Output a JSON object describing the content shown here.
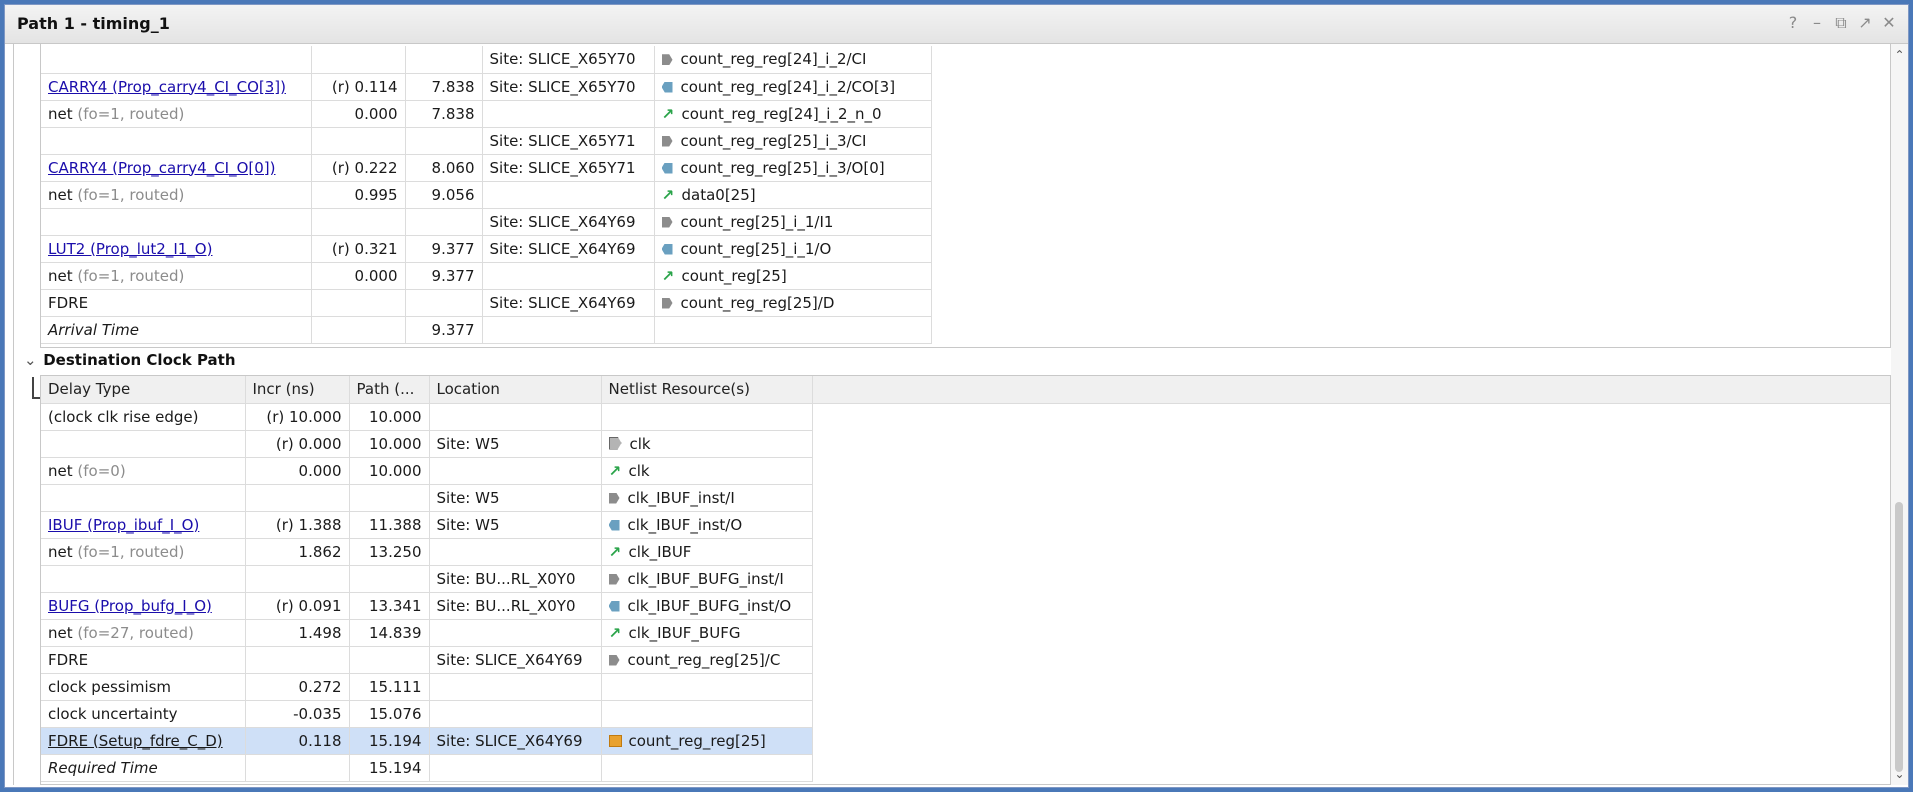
{
  "window": {
    "title": "Path 1 - timing_1",
    "controls": [
      "?",
      "–",
      "⧉",
      "↗",
      "✕"
    ]
  },
  "upper_rows": [
    {
      "delay": "",
      "delay_link": false,
      "incr": "",
      "path": "",
      "location": "Site: SLICE_X65Y70",
      "icon": "pin-in",
      "resource": "count_reg_reg[24]_i_2/CI"
    },
    {
      "delay": "CARRY4 (Prop_carry4_CI_CO[3])",
      "delay_link": true,
      "incr": "(r) 0.114",
      "path": "7.838",
      "location": "Site: SLICE_X65Y70",
      "icon": "pin-out",
      "resource": "count_reg_reg[24]_i_2/CO[3]"
    },
    {
      "delay": "net",
      "muted": "(fo=1, routed)",
      "incr": "0.000",
      "path": "7.838",
      "location": "",
      "icon": "net",
      "resource": "count_reg_reg[24]_i_2_n_0"
    },
    {
      "delay": "",
      "incr": "",
      "path": "",
      "location": "Site: SLICE_X65Y71",
      "icon": "pin-in",
      "resource": "count_reg_reg[25]_i_3/CI"
    },
    {
      "delay": "CARRY4 (Prop_carry4_CI_O[0])",
      "delay_link": true,
      "incr": "(r) 0.222",
      "path": "8.060",
      "location": "Site: SLICE_X65Y71",
      "icon": "pin-out",
      "resource": "count_reg_reg[25]_i_3/O[0]"
    },
    {
      "delay": "net",
      "muted": "(fo=1, routed)",
      "incr": "0.995",
      "path": "9.056",
      "location": "",
      "icon": "net",
      "resource": "data0[25]"
    },
    {
      "delay": "",
      "incr": "",
      "path": "",
      "location": "Site: SLICE_X64Y69",
      "icon": "pin-in",
      "resource": "count_reg[25]_i_1/I1"
    },
    {
      "delay": "LUT2 (Prop_lut2_I1_O)",
      "delay_link": true,
      "incr": "(r) 0.321",
      "path": "9.377",
      "location": "Site: SLICE_X64Y69",
      "icon": "pin-out",
      "resource": "count_reg[25]_i_1/O"
    },
    {
      "delay": "net",
      "muted": "(fo=1, routed)",
      "incr": "0.000",
      "path": "9.377",
      "location": "",
      "icon": "net",
      "resource": "count_reg[25]"
    },
    {
      "delay": "FDRE",
      "incr": "",
      "path": "",
      "location": "Site: SLICE_X64Y69",
      "icon": "pin-in",
      "resource": "count_reg_reg[25]/D"
    },
    {
      "delay": "Arrival Time",
      "bold": true,
      "incr": "",
      "path": "9.377",
      "location": "",
      "icon": "",
      "resource": ""
    }
  ],
  "section": {
    "title": "Destination Clock Path"
  },
  "lower_headers": {
    "delay_type": "Delay Type",
    "incr": "Incr (ns)",
    "path": "Path (...",
    "location": "Location",
    "netlist": "Netlist Resource(s)"
  },
  "lower_rows": [
    {
      "delay": "(clock clk rise edge)",
      "incr": "(r) 10.000",
      "path": "10.000",
      "location": "",
      "icon": "",
      "resource": ""
    },
    {
      "delay": "",
      "incr": "(r) 0.000",
      "path": "10.000",
      "location": "Site: W5",
      "icon": "pin-in-lg",
      "resource": "clk"
    },
    {
      "delay": "net",
      "muted": "(fo=0)",
      "incr": "0.000",
      "path": "10.000",
      "location": "",
      "icon": "net",
      "resource": "clk"
    },
    {
      "delay": "",
      "incr": "",
      "path": "",
      "location": "Site: W5",
      "icon": "pin-in",
      "resource": "clk_IBUF_inst/I"
    },
    {
      "delay": "IBUF (Prop_ibuf_I_O)",
      "delay_link": true,
      "incr": "(r) 1.388",
      "path": "11.388",
      "location": "Site: W5",
      "icon": "pin-out",
      "resource": "clk_IBUF_inst/O"
    },
    {
      "delay": "net",
      "muted": "(fo=1, routed)",
      "incr": "1.862",
      "path": "13.250",
      "location": "",
      "icon": "net",
      "resource": "clk_IBUF"
    },
    {
      "delay": "",
      "incr": "",
      "path": "",
      "location": "Site: BU...RL_X0Y0",
      "icon": "pin-in",
      "resource": "clk_IBUF_BUFG_inst/I"
    },
    {
      "delay": "BUFG (Prop_bufg_I_O)",
      "delay_link": true,
      "incr": "(r) 0.091",
      "path": "13.341",
      "location": "Site: BU...RL_X0Y0",
      "icon": "pin-out",
      "resource": "clk_IBUF_BUFG_inst/O"
    },
    {
      "delay": "net",
      "muted": "(fo=27, routed)",
      "incr": "1.498",
      "path": "14.839",
      "location": "",
      "icon": "net",
      "resource": "clk_IBUF_BUFG"
    },
    {
      "delay": "FDRE",
      "incr": "",
      "path": "",
      "location": "Site: SLICE_X64Y69",
      "icon": "pin-in",
      "resource": "count_reg_reg[25]/C"
    },
    {
      "delay": "clock pessimism",
      "incr": "0.272",
      "path": "15.111",
      "location": "",
      "icon": "",
      "resource": ""
    },
    {
      "delay": "clock uncertainty",
      "incr": "-0.035",
      "path": "15.076",
      "location": "",
      "icon": "",
      "resource": ""
    },
    {
      "delay": "FDRE (Setup_fdre_C_D)",
      "selected": true,
      "incr": "0.118",
      "path": "15.194",
      "location": "Site: SLICE_X64Y69",
      "icon": "reg",
      "resource": "count_reg_reg[25]"
    },
    {
      "delay": "Required Time",
      "bold": true,
      "incr": "",
      "path": "15.194",
      "location": "",
      "icon": "",
      "resource": ""
    }
  ]
}
